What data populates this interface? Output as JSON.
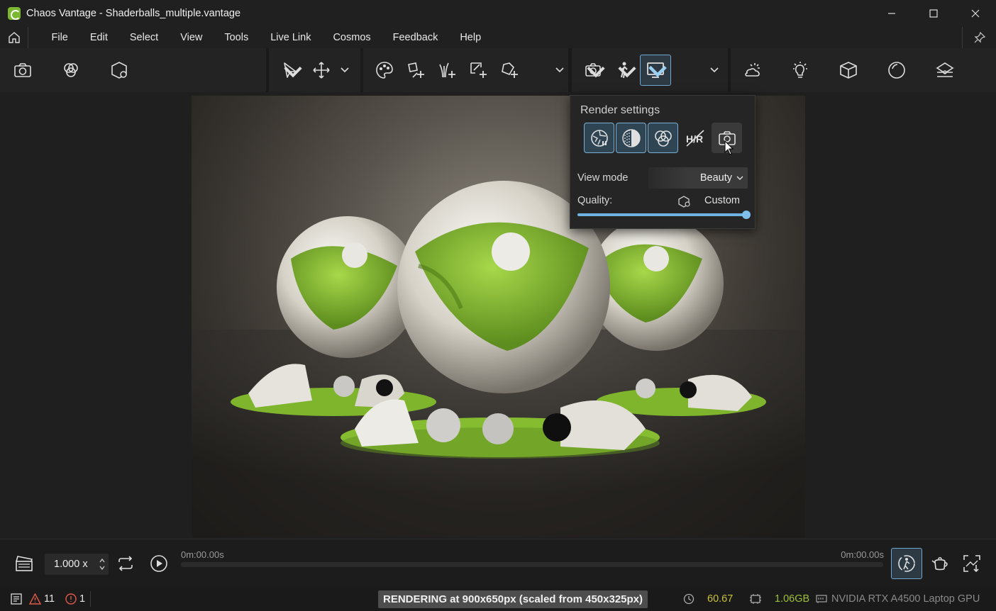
{
  "window": {
    "title": "Chaos Vantage - Shaderballs_multiple.vantage",
    "controls": [
      "minimize-icon",
      "maximize-icon",
      "close-icon"
    ]
  },
  "menu": {
    "items": [
      "File",
      "Edit",
      "Select",
      "View",
      "Tools",
      "Live Link",
      "Cosmos",
      "Feedback",
      "Help"
    ]
  },
  "toolbar": {
    "group1": [
      "camera-icon",
      "render-elements-icon",
      "render-settings-icon"
    ],
    "group2": [
      "select-arrow-icon",
      "move-gizmo-icon"
    ],
    "group3": [
      "material-palette-icon",
      "add-geometry-icon",
      "add-scatter-icon",
      "add-decal-icon",
      "add-light-icon"
    ],
    "group4": [
      "camera-view-icon",
      "walk-mode-icon",
      "viewport-display-icon"
    ],
    "group5": [
      "environment-icon",
      "lighting-icon",
      "object-icon",
      "sphere-icon",
      "layers-icon"
    ]
  },
  "render_settings_popup": {
    "title": "Render settings",
    "buttons": [
      "render-mode-icon",
      "exposure-icon",
      "denoiser-icon",
      "hdr-toggle-icon",
      "snapshot-icon"
    ],
    "hdr_label": "H/R",
    "view_mode_label": "View mode",
    "view_mode_value": "Beauty",
    "quality_label": "Quality:",
    "quality_value": "Custom",
    "quality_level": 1.0
  },
  "timeline": {
    "speed": "1.000 x",
    "time_start": "0m:00.00s",
    "time_end": "0m:00.00s"
  },
  "status": {
    "warnings": "11",
    "errors": "1",
    "render_message": "RENDERING at 900x650px (scaled from 450x325px)",
    "fps": "60.67",
    "memory": "1.06GB",
    "gpu": "NVIDIA RTX A4500 Laptop GPU"
  },
  "colors": {
    "accent": "#6fa8d0",
    "brand_green": "#7cb82f",
    "fps_color": "#c8c23a",
    "memory_color": "#9fbf3a"
  }
}
